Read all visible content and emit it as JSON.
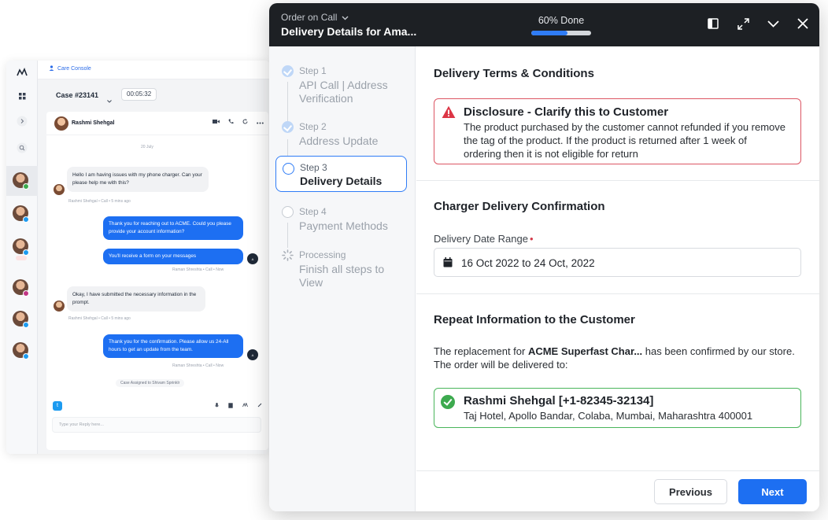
{
  "console": {
    "tab_label": "Care Console",
    "case_title": "Case #23141",
    "case_timer": "00:05:32",
    "chat": {
      "contact_name": "Rashmi Shehgal",
      "date_divider": "20 July",
      "messages": [
        {
          "dir": "in",
          "text": "Hello I am having issues with my phone charger. Can your please help me with this?",
          "meta": "Rashmi Shehgal • Call • 5 mins ago"
        },
        {
          "dir": "out",
          "text": "Thank you for reaching out to ACME. Could you please provide your account information?"
        },
        {
          "dir": "out",
          "text": "You'll receive a form on your messages",
          "meta": "Raman Shreshta • Call • Now"
        },
        {
          "dir": "in",
          "text": "Okay, I have submitted the necessary information in the prompt.",
          "meta": "Rashmi Shehgal • Call • 5 mins ago"
        },
        {
          "dir": "out",
          "text": "Thank you for the confirmation. Please allow us 24-All hours to get an update from the team.",
          "meta": "Raman Shreshta • Call • Now"
        }
      ],
      "system_note": "Case Assigned to Shivam Sprinklr",
      "reply_placeholder": "Type your Reply here..."
    }
  },
  "modal": {
    "subtitle": "Order on Call",
    "title": "Delivery Details for Ama...",
    "progress_label": "60% Done",
    "progress_value": 0.6,
    "steps": [
      {
        "num": "Step 1",
        "label": "API Call | Address Verification",
        "state": "done"
      },
      {
        "num": "Step 2",
        "label": "Address Update",
        "state": "done"
      },
      {
        "num": "Step 3",
        "label": "Delivery Details",
        "state": "active"
      },
      {
        "num": "Step 4",
        "label": "Payment Methods",
        "state": "todo"
      },
      {
        "num": "Processing",
        "label": "Finish all steps to View",
        "state": "processing"
      }
    ],
    "terms": {
      "heading": "Delivery Terms & Conditions",
      "disclosure_title": "Disclosure - Clarify this to Customer",
      "disclosure_body": "The product purchased by the customer cannot refunded if you remove the tag of the product. If the product is returned after 1 week of ordering then it is not eligible for return"
    },
    "charger": {
      "heading": "Charger Delivery Confirmation",
      "field_label": "Delivery Date Range",
      "required_mark": "•",
      "date_value": "16 Oct 2022 to 24 Oct, 2022"
    },
    "repeat": {
      "heading": "Repeat Information to the Customer",
      "text_before": "The replacement for ",
      "product": "ACME Superfast Char...",
      "text_after": " has been confirmed by our store. The order will be delivered to:",
      "contact": "Rashmi Shehgal [+1-82345-32134]",
      "address": "Taj Hotel, Apollo Bandar, Colaba, Mumbai, Maharashtra 400001"
    },
    "footer": {
      "previous_label": "Previous",
      "next_label": "Next"
    }
  },
  "colors": {
    "accent": "#1d6ff2",
    "header_bg": "#1d2024",
    "danger": "#dc5563",
    "success": "#49b55a"
  }
}
